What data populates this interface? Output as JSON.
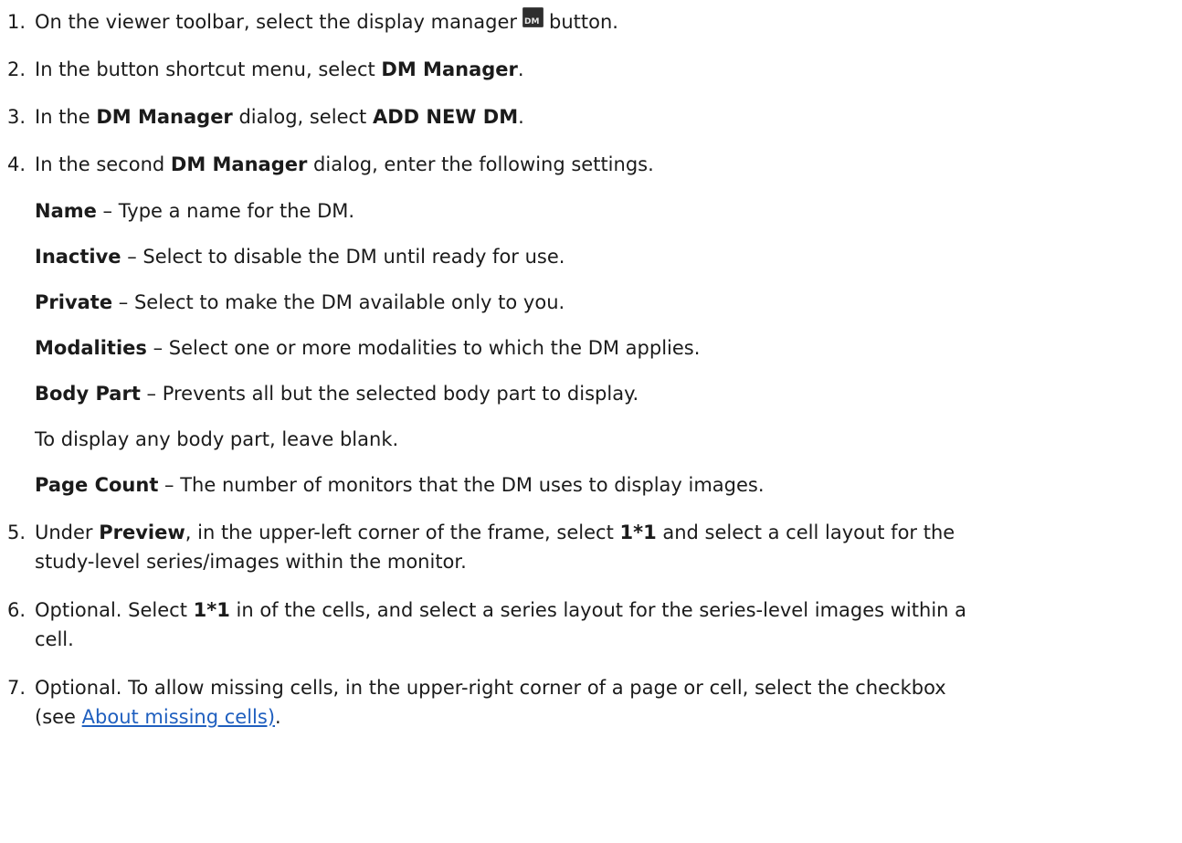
{
  "steps": [
    {
      "num": "1.",
      "parts": [
        "On the viewer toolbar, select the display manager",
        "button."
      ],
      "icon_text": "DM",
      "icon_name": "display-manager-icon"
    },
    {
      "num": "2.",
      "a": "In the button shortcut menu, select ",
      "b": "DM Manager",
      "c": "."
    },
    {
      "num": "3.",
      "a": "In the ",
      "b": "DM Manager",
      "c": " dialog, select ",
      "d": "ADD NEW DM",
      "e": "."
    },
    {
      "num": "4.",
      "a": "In the second ",
      "b": "DM Manager",
      "c": " dialog, enter the following settings."
    },
    {
      "num": "5.",
      "a": "Under ",
      "b": "Preview",
      "c": ", in the upper-left corner of the frame, select ",
      "d": "1*1",
      "e": " and select a cell layout for the",
      "line2": "study-level series/images within the monitor."
    },
    {
      "num": "6.",
      "a": "Optional. Select ",
      "b": "1*1",
      "c": " in of the cells, and select a series layout for the series-level images within a",
      "line2": "cell."
    },
    {
      "num": "7.",
      "a": "Optional. To allow missing cells, in the upper-right corner of a page or cell, select the checkbox",
      "line2_a": "(see ",
      "line2_link": "About missing cells)",
      "line2_b": "."
    }
  ],
  "settings": [
    {
      "term": "Name",
      "desc": " – Type a name for the DM."
    },
    {
      "term": "Inactive",
      "desc": " – Select to disable the DM until ready for use."
    },
    {
      "term": "Private",
      "desc": " – Select to make the DM available only to you."
    },
    {
      "term": "Modalities",
      "desc": " – Select one or more modalities to which the DM applies."
    },
    {
      "term": "Body Part",
      "desc": " – Prevents all but the selected body part to display."
    },
    {
      "term": "",
      "desc": "To display any body part, leave blank."
    },
    {
      "term": "Page Count",
      "desc": " – The number of monitors that the DM uses to display images."
    }
  ],
  "colors": {
    "link": "#1f5fbf",
    "text": "#1b1b1b"
  }
}
